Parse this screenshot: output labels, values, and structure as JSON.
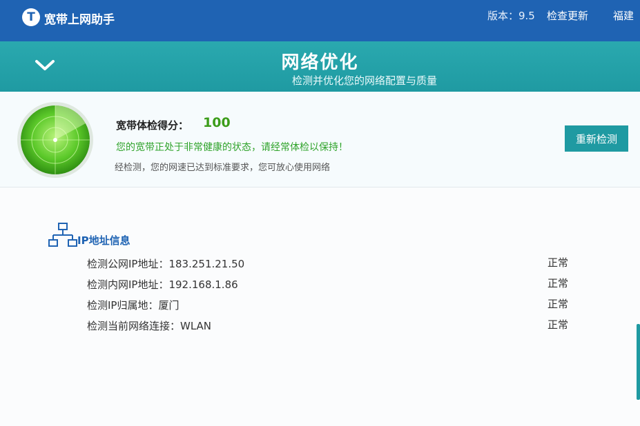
{
  "app": {
    "logo_glyph": "T",
    "title": "宽带上网助手",
    "version": "版本：9.5",
    "check_update": "检查更新",
    "region": "福建"
  },
  "header": {
    "title": "网络优化",
    "subtitle": "检测并优化您的网络配置与质量"
  },
  "score": {
    "label": "宽带体检得分：",
    "value": "100",
    "health_text": "您的宽带正处于非常健康的状态，请经常体检以保持！",
    "note": "经检测，您的网速已达到标准要求，您可放心使用网络",
    "recheck_label": "重新检测"
  },
  "ip_info": {
    "title": "IP地址信息",
    "rows": [
      {
        "label": "检测公网IP地址：183.251.21.50",
        "status": "正常"
      },
      {
        "label": "检测内网IP地址：192.168.1.86",
        "status": "正常"
      },
      {
        "label": "检测IP归属地：厦门",
        "status": "正常"
      },
      {
        "label": "检测当前网络连接：WLAN",
        "status": "正常"
      }
    ]
  },
  "colors": {
    "topbar": "#1f63b3",
    "header": "#1f9aa2",
    "score_green": "#3c9d1a",
    "link_blue": "#1f63b3"
  },
  "icons": [
    "app-logo-icon",
    "chevron-down-icon",
    "radar-icon",
    "network-icon"
  ]
}
